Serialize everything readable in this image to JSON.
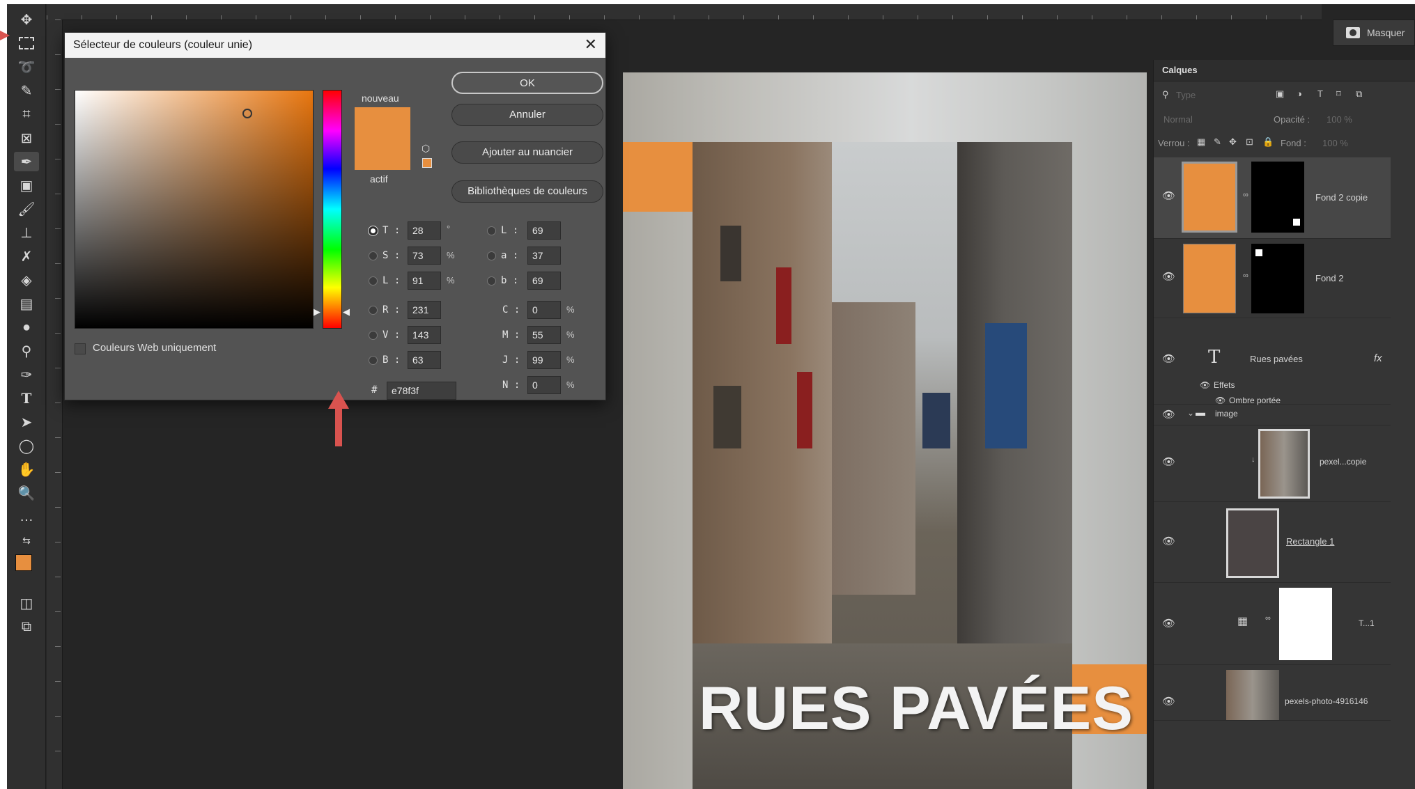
{
  "app": {
    "masks_label": "Masquer"
  },
  "dialog": {
    "title": "Sélecteur de couleurs (couleur unie)",
    "new_label": "nouveau",
    "current_label": "actif",
    "web_only_label": "Couleurs Web uniquement",
    "buttons": {
      "ok": "OK",
      "cancel": "Annuler",
      "add_swatch": "Ajouter au nuancier",
      "libraries": "Bibliothèques de couleurs"
    },
    "hsb": [
      {
        "label": "T :",
        "value": "28",
        "unit": "°"
      },
      {
        "label": "S :",
        "value": "73",
        "unit": "%"
      },
      {
        "label": "L :",
        "value": "91",
        "unit": "%"
      }
    ],
    "rgb": [
      {
        "label": "R :",
        "value": "231"
      },
      {
        "label": "V :",
        "value": "143"
      },
      {
        "label": "B :",
        "value": "63"
      }
    ],
    "lab": [
      {
        "label": "L :",
        "value": "69"
      },
      {
        "label": "a :",
        "value": "37"
      },
      {
        "label": "b :",
        "value": "69"
      }
    ],
    "cmyk": [
      {
        "label": "C :",
        "value": "0",
        "unit": "%"
      },
      {
        "label": "M :",
        "value": "55",
        "unit": "%"
      },
      {
        "label": "J :",
        "value": "99",
        "unit": "%"
      },
      {
        "label": "N :",
        "value": "0",
        "unit": "%"
      }
    ],
    "hex_prefix": "#",
    "hex": "e78f3f",
    "color": "#e78f3f"
  },
  "layers": {
    "title": "Calques",
    "search_placeholder": "Type",
    "blend_mode": "Normal",
    "opacity_label": "Opacité :",
    "opacity_value": "100 %",
    "lock_label": "Verrou :",
    "fill_label": "Fond :",
    "fill_value": "100 %",
    "items": [
      {
        "name": "Fond 2 copie"
      },
      {
        "name": "Fond 2"
      },
      {
        "name": "Rues pavées",
        "fx": "fx"
      },
      {
        "name": "Effets"
      },
      {
        "name": "Ombre portée"
      },
      {
        "name": "image"
      },
      {
        "name": "pexel...copie"
      },
      {
        "name": "Rectangle 1"
      },
      {
        "name": "T...1"
      },
      {
        "name": "pexels-photo-4916146"
      }
    ]
  },
  "poster": {
    "title": "RUES PAVÉES",
    "accent": "#e78f3f"
  }
}
